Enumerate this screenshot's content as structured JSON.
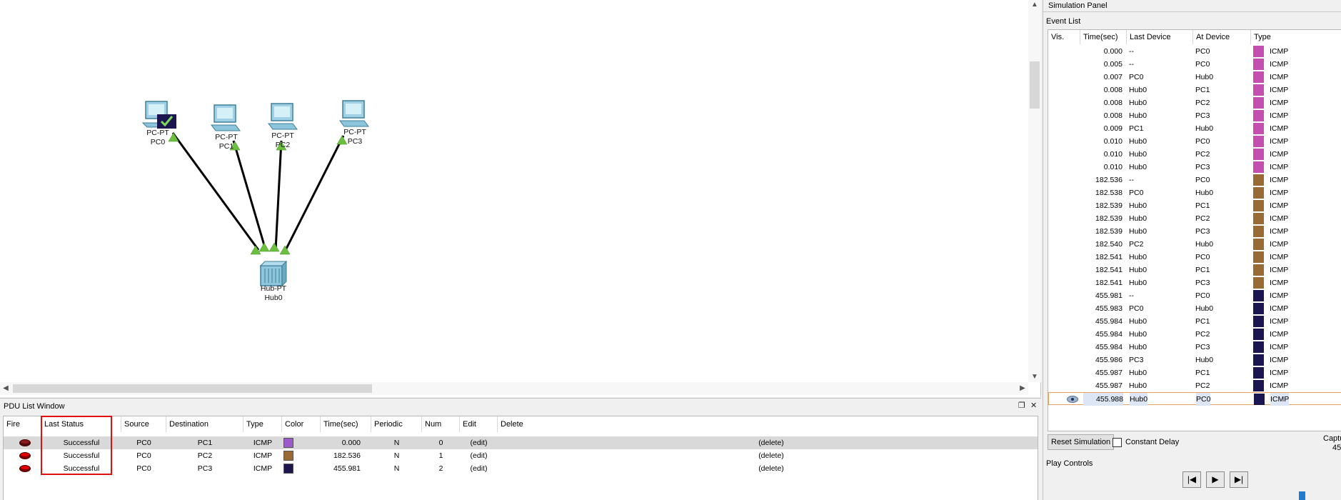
{
  "workspace": {
    "devices": [
      {
        "id": "pc0",
        "model": "PC-PT",
        "name": "PC0",
        "status": "pdu-success"
      },
      {
        "id": "pc1",
        "model": "PC-PT",
        "name": "PC1"
      },
      {
        "id": "pc2",
        "model": "PC-PT",
        "name": "PC2"
      },
      {
        "id": "pc3",
        "model": "PC-PT",
        "name": "PC3"
      },
      {
        "id": "hub0",
        "model": "Hub-PT",
        "name": "Hub0"
      }
    ],
    "link_color": "#000000",
    "port_indicator_color": "#6cbf3f"
  },
  "pdu_window": {
    "title": "PDU List Window",
    "columns": [
      "Fire",
      "Last Status",
      "Source",
      "Destination",
      "Type",
      "Color",
      "Time(sec)",
      "Periodic",
      "Num",
      "Edit",
      "Delete"
    ],
    "rows": [
      {
        "last_status": "Successful",
        "source": "PC0",
        "destination": "PC1",
        "type": "ICMP",
        "color": "#9b59c9",
        "time": "0.000",
        "periodic": "N",
        "num": "0",
        "edit": "(edit)",
        "delete": "(delete)"
      },
      {
        "last_status": "Successful",
        "source": "PC0",
        "destination": "PC2",
        "type": "ICMP",
        "color": "#9a6a35",
        "time": "182.536",
        "periodic": "N",
        "num": "1",
        "edit": "(edit)",
        "delete": "(delete)"
      },
      {
        "last_status": "Successful",
        "source": "PC0",
        "destination": "PC3",
        "type": "ICMP",
        "color": "#1c1650",
        "time": "455.981",
        "periodic": "N",
        "num": "2",
        "edit": "(edit)",
        "delete": "(delete)"
      }
    ]
  },
  "sim_panel": {
    "title": "Simulation Panel",
    "event_list_label": "Event List",
    "columns": [
      "Vis.",
      "Time(sec)",
      "Last Device",
      "At Device",
      "Type"
    ],
    "events": [
      {
        "time": "0.000",
        "last": "--",
        "at": "PC0",
        "color": "#c44fb0",
        "type": "ICMP"
      },
      {
        "time": "0.005",
        "last": "--",
        "at": "PC0",
        "color": "#c44fb0",
        "type": "ICMP"
      },
      {
        "time": "0.007",
        "last": "PC0",
        "at": "Hub0",
        "color": "#c44fb0",
        "type": "ICMP"
      },
      {
        "time": "0.008",
        "last": "Hub0",
        "at": "PC1",
        "color": "#c44fb0",
        "type": "ICMP"
      },
      {
        "time": "0.008",
        "last": "Hub0",
        "at": "PC2",
        "color": "#c44fb0",
        "type": "ICMP"
      },
      {
        "time": "0.008",
        "last": "Hub0",
        "at": "PC3",
        "color": "#c44fb0",
        "type": "ICMP"
      },
      {
        "time": "0.009",
        "last": "PC1",
        "at": "Hub0",
        "color": "#c44fb0",
        "type": "ICMP"
      },
      {
        "time": "0.010",
        "last": "Hub0",
        "at": "PC0",
        "color": "#c44fb0",
        "type": "ICMP"
      },
      {
        "time": "0.010",
        "last": "Hub0",
        "at": "PC2",
        "color": "#c44fb0",
        "type": "ICMP"
      },
      {
        "time": "0.010",
        "last": "Hub0",
        "at": "PC3",
        "color": "#c44fb0",
        "type": "ICMP"
      },
      {
        "time": "182.536",
        "last": "--",
        "at": "PC0",
        "color": "#9a6a35",
        "type": "ICMP"
      },
      {
        "time": "182.538",
        "last": "PC0",
        "at": "Hub0",
        "color": "#9a6a35",
        "type": "ICMP"
      },
      {
        "time": "182.539",
        "last": "Hub0",
        "at": "PC1",
        "color": "#9a6a35",
        "type": "ICMP"
      },
      {
        "time": "182.539",
        "last": "Hub0",
        "at": "PC2",
        "color": "#9a6a35",
        "type": "ICMP"
      },
      {
        "time": "182.539",
        "last": "Hub0",
        "at": "PC3",
        "color": "#9a6a35",
        "type": "ICMP"
      },
      {
        "time": "182.540",
        "last": "PC2",
        "at": "Hub0",
        "color": "#9a6a35",
        "type": "ICMP"
      },
      {
        "time": "182.541",
        "last": "Hub0",
        "at": "PC0",
        "color": "#9a6a35",
        "type": "ICMP"
      },
      {
        "time": "182.541",
        "last": "Hub0",
        "at": "PC1",
        "color": "#9a6a35",
        "type": "ICMP"
      },
      {
        "time": "182.541",
        "last": "Hub0",
        "at": "PC3",
        "color": "#9a6a35",
        "type": "ICMP"
      },
      {
        "time": "455.981",
        "last": "--",
        "at": "PC0",
        "color": "#1c1650",
        "type": "ICMP"
      },
      {
        "time": "455.983",
        "last": "PC0",
        "at": "Hub0",
        "color": "#1c1650",
        "type": "ICMP"
      },
      {
        "time": "455.984",
        "last": "Hub0",
        "at": "PC1",
        "color": "#1c1650",
        "type": "ICMP"
      },
      {
        "time": "455.984",
        "last": "Hub0",
        "at": "PC2",
        "color": "#1c1650",
        "type": "ICMP"
      },
      {
        "time": "455.984",
        "last": "Hub0",
        "at": "PC3",
        "color": "#1c1650",
        "type": "ICMP"
      },
      {
        "time": "455.986",
        "last": "PC3",
        "at": "Hub0",
        "color": "#1c1650",
        "type": "ICMP"
      },
      {
        "time": "455.987",
        "last": "Hub0",
        "at": "PC1",
        "color": "#1c1650",
        "type": "ICMP"
      },
      {
        "time": "455.987",
        "last": "Hub0",
        "at": "PC2",
        "color": "#1c1650",
        "type": "ICMP"
      },
      {
        "time": "455.988",
        "last": "Hub0",
        "at": "PC0",
        "color": "#1c1650",
        "type": "ICMP",
        "current": true
      }
    ],
    "reset_label": "Reset Simulation",
    "constant_delay_label": "Constant Delay",
    "capture_partial": "Captu",
    "capture_value_partial": "45",
    "play_controls_label": "Play Controls"
  }
}
